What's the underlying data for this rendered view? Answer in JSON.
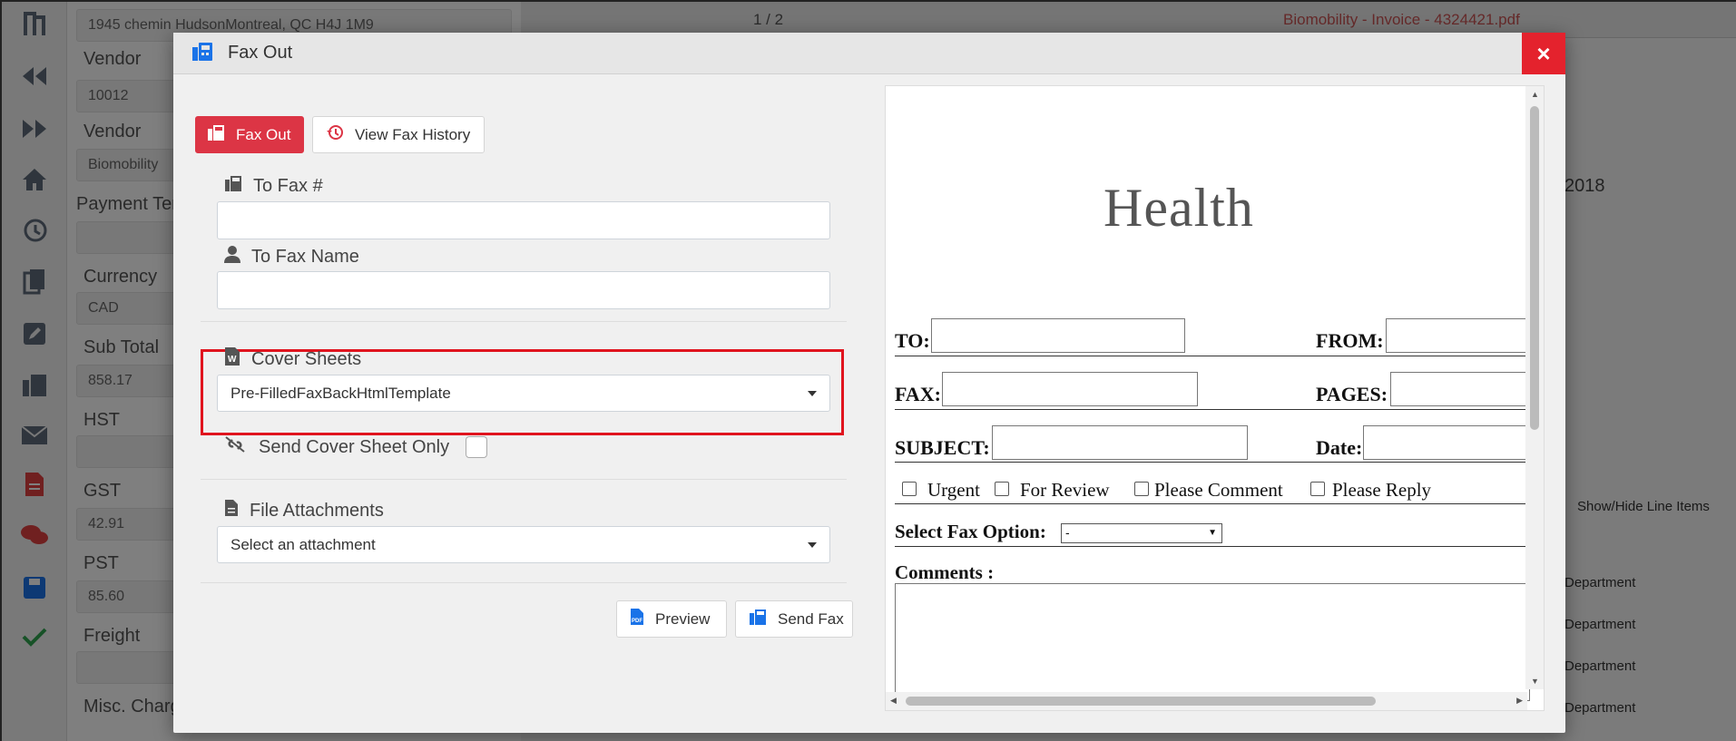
{
  "background": {
    "address": "1945 chemin HudsonMontreal, QC H4J 1M9",
    "fields": [
      {
        "label": "Vendor",
        "value": "10012"
      },
      {
        "label": "Vendor",
        "value": "Biomobility"
      },
      {
        "label": "Payment Terms",
        "value": ""
      },
      {
        "label": "Currency",
        "value": "CAD"
      },
      {
        "label": "Sub Total",
        "value": "858.17"
      },
      {
        "label": "HST",
        "value": ""
      },
      {
        "label": "GST",
        "value": "42.91"
      },
      {
        "label": "PST",
        "value": "85.60"
      },
      {
        "label": "Freight",
        "value": ""
      },
      {
        "label": "Misc. Charges",
        "value": ""
      }
    ],
    "page_indicator": "1 / 2",
    "pdf_title": "Biomobility - Invoice - 4324421.pdf",
    "date_fragment": "2018",
    "show_hide_line_items": "Show/Hide Line Items",
    "department_labels": [
      "Department",
      "Department",
      "Department",
      "Department"
    ]
  },
  "modal": {
    "title": "Fax Out",
    "close": "×",
    "buttons": {
      "fax_out": "Fax Out",
      "view_fax_history": "View Fax History",
      "preview": "Preview",
      "send_fax": "Send Fax"
    },
    "form": {
      "to_fax_label": "To Fax #",
      "to_fax_value": "",
      "to_fax_name_label": "To Fax Name",
      "to_fax_name_value": "",
      "cover_sheets_label": "Cover Sheets",
      "cover_sheets_selected": "Pre-FilledFaxBackHtmlTemplate",
      "send_cover_only_label": "Send Cover Sheet Only",
      "file_attachments_label": "File Attachments",
      "file_attachments_selected": "Select an attachment"
    },
    "preview": {
      "logo_text": "Health",
      "to_label": "TO:",
      "from_label": "FROM:",
      "fax_label": "FAX:",
      "pages_label": "PAGES:",
      "subject_label": "SUBJECT:",
      "date_label": "Date:",
      "checkboxes": [
        "Urgent",
        "For Review",
        "Please Comment",
        "Please Reply"
      ],
      "fax_option_label": "Select Fax Option:",
      "fax_option_selected": "-",
      "comments_label": "Comments :"
    }
  },
  "colors": {
    "primary_red": "#dc3545",
    "close_red": "#e4222d",
    "highlight_red": "#e0141e",
    "icon_blue": "#1a73e8",
    "sidebar_icon": "#5f6b7a"
  }
}
